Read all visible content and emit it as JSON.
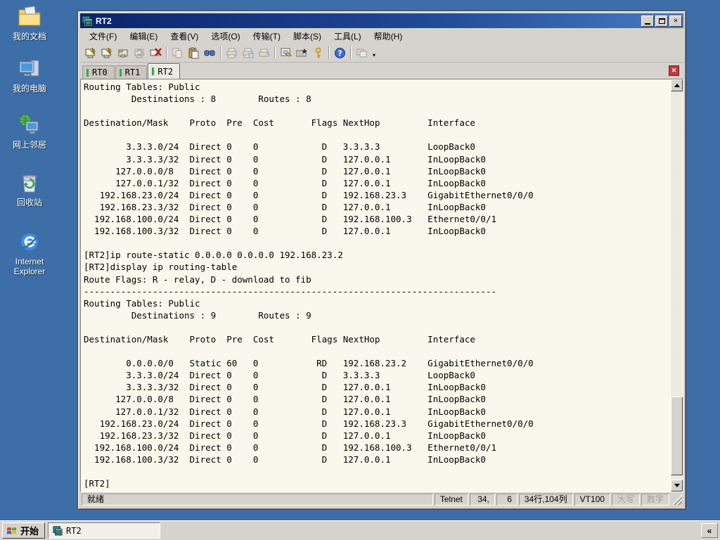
{
  "colors": {
    "desktop_blue": "#3D6EA8",
    "title_gradient_start": "#0B246A",
    "title_gradient_end": "#4878C0",
    "terminal_bg": "#FAF8EC",
    "terminal_text": "#000000",
    "tab_indicator_green": "#2FAE4A",
    "tab_close_red": "#C03A3A",
    "chrome_gray": "#D6D3CE"
  },
  "desktop": {
    "icons": [
      {
        "name": "my-documents",
        "label": "我的文档"
      },
      {
        "name": "my-computer",
        "label": "我的电脑"
      },
      {
        "name": "network-places",
        "label": "网上邻居"
      },
      {
        "name": "recycle-bin",
        "label": "回收站"
      },
      {
        "name": "internet-explorer",
        "label": "Internet Explorer"
      }
    ]
  },
  "window": {
    "title": "RT2",
    "controls": {
      "minimize": "_",
      "maximize": "□",
      "close": "×"
    }
  },
  "menu": {
    "items": [
      {
        "label": "文件(F)"
      },
      {
        "label": "编辑(E)"
      },
      {
        "label": "查看(V)"
      },
      {
        "label": "选项(O)"
      },
      {
        "label": "传输(T)"
      },
      {
        "label": "脚本(S)"
      },
      {
        "label": "工具(L)"
      },
      {
        "label": "帮助(H)"
      }
    ]
  },
  "toolbar": {
    "buttons": [
      {
        "icon": "quick-connect-icon",
        "disabled": false
      },
      {
        "icon": "connect-icon",
        "disabled": false
      },
      {
        "icon": "connect-in-tab-icon",
        "disabled": false
      },
      {
        "icon": "reconnect-icon",
        "disabled": true
      },
      {
        "icon": "disconnect-icon",
        "disabled": false
      },
      {
        "icon": "copy-icon",
        "disabled": true
      },
      {
        "icon": "paste-icon",
        "disabled": false
      },
      {
        "icon": "find-icon",
        "disabled": false
      },
      {
        "icon": "print-icon",
        "disabled": true
      },
      {
        "icon": "print-selection-icon",
        "disabled": true
      },
      {
        "icon": "printer-setup-icon",
        "disabled": true
      },
      {
        "icon": "session-options-icon",
        "disabled": false
      },
      {
        "icon": "keymap-icon",
        "disabled": false
      },
      {
        "icon": "key-icon",
        "disabled": false
      },
      {
        "icon": "help-icon",
        "disabled": false
      },
      {
        "icon": "app-window-icon",
        "disabled": true
      }
    ],
    "overflow": "▾"
  },
  "tabs": [
    {
      "label": "RT0",
      "active": false
    },
    {
      "label": "RT1",
      "active": false
    },
    {
      "label": "RT2",
      "active": true
    }
  ],
  "terminal": {
    "lines": [
      "Routing Tables: Public",
      "         Destinations : 8        Routes : 8",
      "",
      "Destination/Mask    Proto  Pre  Cost       Flags NextHop         Interface",
      "",
      "        3.3.3.0/24  Direct 0    0            D   3.3.3.3         LoopBack0",
      "        3.3.3.3/32  Direct 0    0            D   127.0.0.1       InLoopBack0",
      "      127.0.0.0/8   Direct 0    0            D   127.0.0.1       InLoopBack0",
      "      127.0.0.1/32  Direct 0    0            D   127.0.0.1       InLoopBack0",
      "   192.168.23.0/24  Direct 0    0            D   192.168.23.3    GigabitEthernet0/0/0",
      "   192.168.23.3/32  Direct 0    0            D   127.0.0.1       InLoopBack0",
      "  192.168.100.0/24  Direct 0    0            D   192.168.100.3   Ethernet0/0/1",
      "  192.168.100.3/32  Direct 0    0            D   127.0.0.1       InLoopBack0",
      "",
      "[RT2]ip route-static 0.0.0.0 0.0.0.0 192.168.23.2",
      "[RT2]display ip routing-table",
      "Route Flags: R - relay, D - download to fib",
      "------------------------------------------------------------------------------",
      "Routing Tables: Public",
      "         Destinations : 9        Routes : 9",
      "",
      "Destination/Mask    Proto  Pre  Cost       Flags NextHop         Interface",
      "",
      "        0.0.0.0/0   Static 60   0           RD   192.168.23.2    GigabitEthernet0/0/0",
      "        3.3.3.0/24  Direct 0    0            D   3.3.3.3         LoopBack0",
      "        3.3.3.3/32  Direct 0    0            D   127.0.0.1       InLoopBack0",
      "      127.0.0.0/8   Direct 0    0            D   127.0.0.1       InLoopBack0",
      "      127.0.0.1/32  Direct 0    0            D   127.0.0.1       InLoopBack0",
      "   192.168.23.0/24  Direct 0    0            D   192.168.23.3    GigabitEthernet0/0/0",
      "   192.168.23.3/32  Direct 0    0            D   127.0.0.1       InLoopBack0",
      "  192.168.100.0/24  Direct 0    0            D   192.168.100.3   Ethernet0/0/1",
      "  192.168.100.3/32  Direct 0    0            D   127.0.0.1       InLoopBack0",
      "",
      "[RT2]"
    ]
  },
  "status_bar": {
    "ready": "就绪",
    "protocol": "Telnet",
    "cursor_row": "34,",
    "cursor_col": "6",
    "screen_size": "34行,104列",
    "emulation": "VT100",
    "caps_indicator": "大写",
    "num_indicator": "数字"
  },
  "taskbar": {
    "start_label": "开始",
    "tasks": [
      {
        "label": "RT2"
      }
    ],
    "collapse_label": "«"
  }
}
